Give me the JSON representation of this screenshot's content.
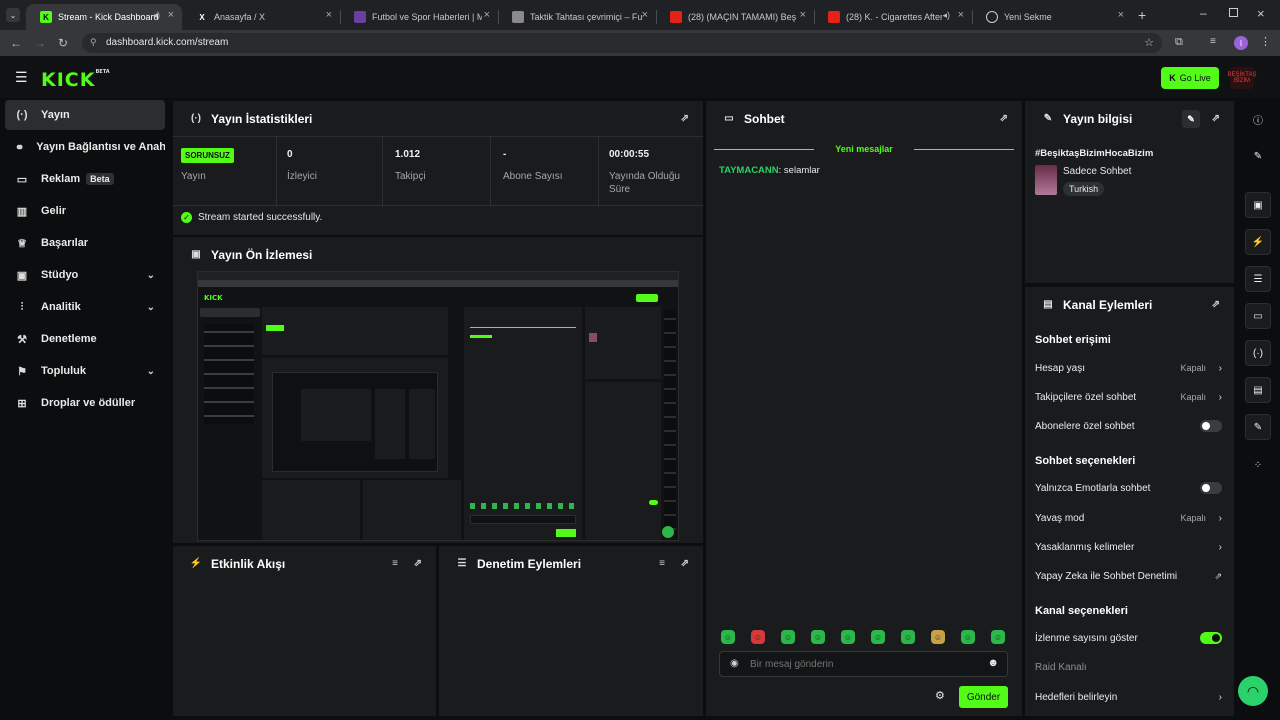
{
  "browser": {
    "tabs": [
      {
        "title": "Stream - Kick Dashboard",
        "favicon": "kick-favicon",
        "audio": true,
        "active": true
      },
      {
        "title": "Anasayfa / X",
        "favicon": "x-favicon"
      },
      {
        "title": "Futbol ve Spor Haberleri | Maç",
        "favicon": "news-favicon"
      },
      {
        "title": "Taktik Tahtası çevrimiçi – Futbol",
        "favicon": "board-favicon"
      },
      {
        "title": "(28) (MAÇIN TAMAMI) Beşiktaş",
        "favicon": "youtube-favicon",
        "audio": true
      },
      {
        "title": "(28) K. - Cigarettes After Sex",
        "favicon": "youtube-favicon",
        "audio": true
      },
      {
        "title": "Yeni Sekme",
        "favicon": "chrome-favicon"
      }
    ],
    "url": "dashboard.kick.com/stream",
    "profile_initial": "I"
  },
  "header": {
    "logo": "KICK",
    "logo_badge": "BETA",
    "go_live_label": "Go Live",
    "avatar_text": "BEŞİKTAŞ BİZİM"
  },
  "sidebar": {
    "items": [
      {
        "label": "Yayın",
        "icon": "stream-icon",
        "active": true
      },
      {
        "label": "Yayın Bağlantısı ve Anahtar",
        "icon": "link-icon"
      },
      {
        "label": "Reklam",
        "icon": "ad-icon",
        "badge": "Beta"
      },
      {
        "label": "Gelir",
        "icon": "revenue-icon"
      },
      {
        "label": "Başarılar",
        "icon": "trophy-icon"
      },
      {
        "label": "Stüdyo",
        "icon": "studio-icon",
        "expandable": true
      },
      {
        "label": "Analitik",
        "icon": "analytics-icon",
        "expandable": true
      },
      {
        "label": "Denetleme",
        "icon": "moderation-icon"
      },
      {
        "label": "Topluluk",
        "icon": "community-icon",
        "expandable": true
      },
      {
        "label": "Droplar ve ödüller",
        "icon": "drops-icon"
      }
    ]
  },
  "stats_panel": {
    "title": "Yayın İstatistikleri",
    "status_badge": "SORUNSUZ",
    "status_label": "Yayın",
    "stats": [
      {
        "value": "0",
        "label": "İzleyici"
      },
      {
        "value": "1.012",
        "label": "Takipçi"
      },
      {
        "value": "-",
        "label": "Abone Sayısı"
      },
      {
        "value": "00:00:55",
        "label": "Yayında Olduğu Süre"
      }
    ],
    "message": "Stream started successfully."
  },
  "preview_panel": {
    "title": "Yayın Ön İzlemesi"
  },
  "activity_panel": {
    "title": "Etkinlik Akışı"
  },
  "moderation_panel": {
    "title": "Denetim Eylemleri"
  },
  "chat": {
    "title": "Sohbet",
    "new_messages": "Yeni mesajlar",
    "messages": [
      {
        "user": "TAYMACANN",
        "text": "selamlar"
      }
    ],
    "input_placeholder": "Bir mesaj gönderin",
    "send_label": "Gönder"
  },
  "stream_info": {
    "title": "Yayın bilgisi",
    "stream_title": "#BeşiktaşBizimHocaBizim",
    "category": "Sadece Sohbet",
    "language": "Turkish"
  },
  "channel_actions": {
    "title": "Kanal Eylemleri",
    "sections": [
      {
        "heading": "Sohbet erişimi",
        "rows": [
          {
            "label": "Hesap yaşı",
            "value": "Kapalı",
            "control": "chevron"
          },
          {
            "label": "Takipçilere özel sohbet",
            "value": "Kapalı",
            "control": "chevron"
          },
          {
            "label": "Abonelere özel sohbet",
            "control": "toggle",
            "on": false
          }
        ]
      },
      {
        "heading": "Sohbet seçenekleri",
        "rows": [
          {
            "label": "Yalnızca Emotlarla sohbet",
            "control": "toggle",
            "on": false
          },
          {
            "label": "Yavaş mod",
            "value": "Kapalı",
            "control": "chevron"
          },
          {
            "label": "Yasaklanmış kelimeler",
            "control": "chevron"
          },
          {
            "label": "Yapay Zeka ile Sohbet Denetimi",
            "control": "external"
          }
        ]
      },
      {
        "heading": "Kanal seçenekleri",
        "rows": [
          {
            "label": "İzlenme sayısını göster",
            "control": "toggle",
            "on": true
          },
          {
            "label": "Raid Kanalı",
            "control": "none",
            "muted": true
          },
          {
            "label": "Hedefleri belirleyin",
            "control": "chevron"
          }
        ]
      }
    ]
  },
  "colors": {
    "accent": "#53fc18",
    "panel": "#191b1d",
    "background": "#0b0d0e"
  }
}
